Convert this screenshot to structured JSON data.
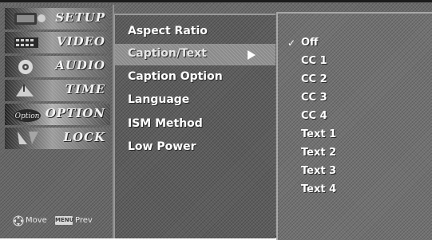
{
  "categories": [
    {
      "label": "SETUP",
      "icon": "setup-icon"
    },
    {
      "label": "VIDEO",
      "icon": "video-icon"
    },
    {
      "label": "AUDIO",
      "icon": "audio-icon"
    },
    {
      "label": "TIME",
      "icon": "time-icon"
    },
    {
      "label": "OPTION",
      "icon": "option-icon",
      "icon_text": "Option",
      "selected": true
    },
    {
      "label": "LOCK",
      "icon": "lock-icon"
    }
  ],
  "hints": {
    "move_label": "Move",
    "menu_key": "MENU",
    "prev_label": "Prev"
  },
  "menu": {
    "items": [
      {
        "label": "Aspect Ratio"
      },
      {
        "label": "Caption/Text",
        "selected": true
      },
      {
        "label": "Caption Option"
      },
      {
        "label": "Language"
      },
      {
        "label": "ISM Method"
      },
      {
        "label": "Low Power"
      }
    ]
  },
  "options": {
    "items": [
      {
        "label": "Off",
        "checked": true
      },
      {
        "label": "CC 1"
      },
      {
        "label": "CC 2"
      },
      {
        "label": "CC 3"
      },
      {
        "label": "CC 4"
      },
      {
        "label": "Text 1"
      },
      {
        "label": "Text 2"
      },
      {
        "label": "Text 3"
      },
      {
        "label": "Text 4"
      }
    ]
  },
  "colors": {
    "panel": "#6b6b6b",
    "highlight": "#8a8a8a",
    "text": "#ffffff"
  }
}
